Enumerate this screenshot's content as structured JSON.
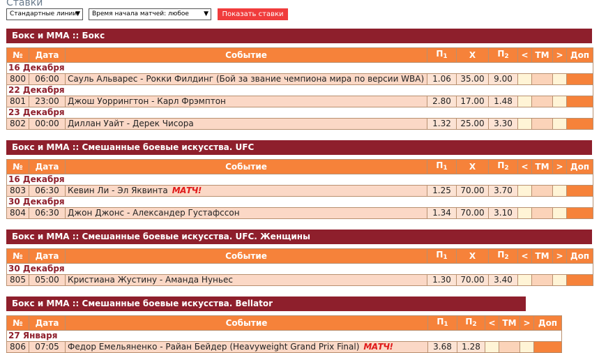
{
  "page": {
    "title": "Ставки"
  },
  "filters": {
    "lines_select": "Стандартные линии",
    "time_select": "Время начала матчей: любое",
    "show_button": "Показать ставки"
  },
  "headers": {
    "num": "№",
    "date": "Дата",
    "event": "Событие",
    "p1": "П",
    "p1_sub": "1",
    "x": "Х",
    "p2": "П",
    "p2_sub": "2",
    "lt": "<",
    "tm": "ТМ",
    "gt": ">",
    "more": "Доп"
  },
  "sections": [
    {
      "title": "Бокс и ММА :: Бокс",
      "days": [
        {
          "date": "16 Декабря",
          "events": [
            {
              "num": "800",
              "time": "06:00",
              "name": "Сауль Альварес - Рокки Филдинг (Бой за звание чемпиона мира по версии WBA)",
              "p1": "1.06",
              "x": "35.00",
              "p2": "9.00"
            }
          ]
        },
        {
          "date": "22 Декабря",
          "events": [
            {
              "num": "801",
              "time": "23:00",
              "name": "Джош Уоррингтон - Карл Фрэмптон",
              "p1": "2.80",
              "x": "17.00",
              "p2": "1.48"
            }
          ]
        },
        {
          "date": "23 Декабря",
          "events": [
            {
              "num": "802",
              "time": "00:00",
              "name": "Диллан Уайт - Дерек Чисора",
              "p1": "1.32",
              "x": "25.00",
              "p2": "3.30"
            }
          ]
        }
      ]
    },
    {
      "title": "Бокс и ММА :: Смешанные боевые искусства. UFC",
      "days": [
        {
          "date": "16 Декабря",
          "events": [
            {
              "num": "803",
              "time": "06:30",
              "name": "Кевин Ли - Эл Яквинта",
              "logo": "МАТЧ!",
              "p1": "1.25",
              "x": "70.00",
              "p2": "3.70"
            }
          ]
        },
        {
          "date": "30 Декабря",
          "events": [
            {
              "num": "804",
              "time": "06:30",
              "name": "Джон Джонс - Александер Густафссон",
              "p1": "1.34",
              "x": "70.00",
              "p2": "3.10"
            }
          ]
        }
      ]
    },
    {
      "title": "Бокс и ММА :: Смешанные боевые искусства. UFC. Женщины",
      "days": [
        {
          "date": "30 Декабря",
          "events": [
            {
              "num": "805",
              "time": "05:00",
              "name": "Кристиана Жустину - Аманда Нуньес",
              "p1": "1.30",
              "x": "70.00",
              "p2": "3.40"
            }
          ]
        }
      ]
    },
    {
      "title": "Бокс и ММА :: Смешанные боевые искусства. Bellator",
      "days": [
        {
          "date": "27 Января",
          "events": [
            {
              "num": "806",
              "time": "07:05",
              "name": "Федор Емельяненко - Райан Бейдер (Heavyweight Grand Prix Final)",
              "logo": "МАТЧ!",
              "p1": "3.68",
              "p2": "1.28"
            }
          ]
        }
      ]
    }
  ],
  "colors": {
    "section_header": "#8e1f2c",
    "table_header": "#f6823a",
    "row": "#fbd8c6",
    "button": "#f03c3c"
  }
}
